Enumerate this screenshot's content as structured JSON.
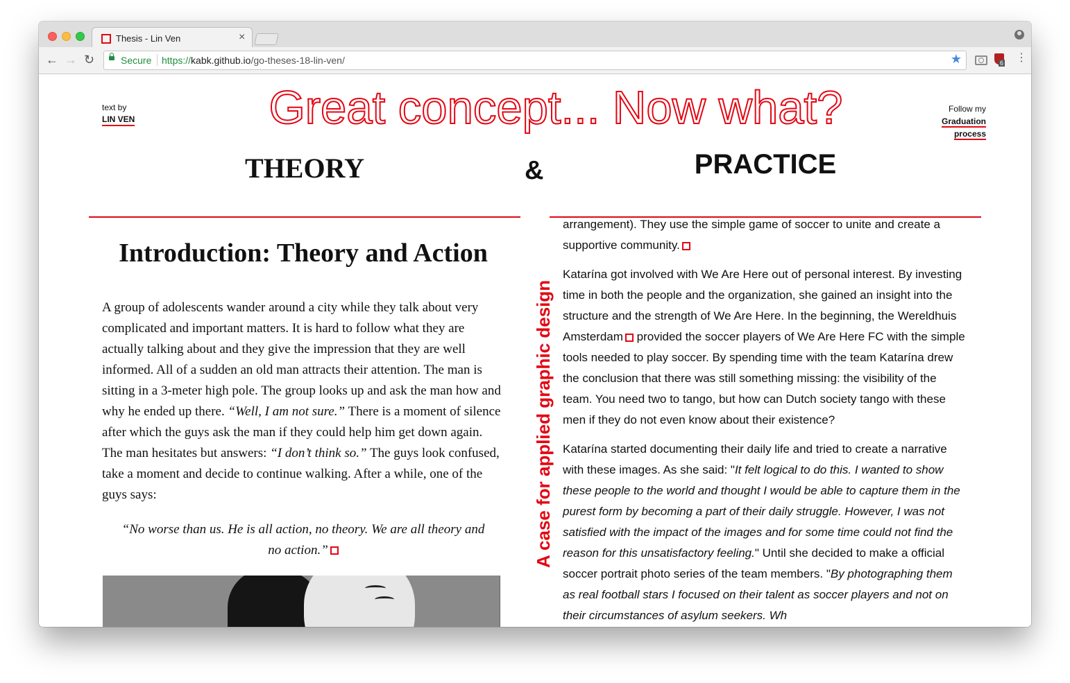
{
  "browser": {
    "tab_title": "Thesis - Lin Ven",
    "tab_close": "×",
    "secure_label": "Secure",
    "url_scheme": "https://",
    "url_host": "kabk.github.io",
    "url_path": "/go-theses-18-lin-ven/",
    "extension_badge": "6",
    "back_icon": "←",
    "forward_icon": "→",
    "reload_icon": "↻",
    "star_icon": "★",
    "menu_icon": "⋮"
  },
  "header": {
    "author_label": "text by",
    "author_name": "LIN VEN",
    "headline": "Great concept... Now what?",
    "follow_label": "Follow my",
    "follow_link_1": "Graduation",
    "follow_link_2": "process"
  },
  "columns": {
    "theory": "THEORY",
    "amp": "&",
    "practice": "PRACTICE",
    "vertical_tagline": "A case for applied graphic design"
  },
  "theory": {
    "title": "Introduction: Theory and Action",
    "p1_a": "A group of adolescents wander around a city while they talk about very complicated and important matters. It is hard to follow what they are actually talking about and they give the impression that they are well informed. All of a sudden an old man attracts their attention. The man is sitting in a 3-meter high pole. The group looks up and ask the man how and why he ended up there. ",
    "p1_quote1": "“Well, I am not sure.”",
    "p1_b": " There is a moment of silence after which the guys ask the man if they could help him get down again. The man hesitates but answers: ",
    "p1_quote2": "“I don’t think so.”",
    "p1_c": " The guys look confused, take a moment and decide to continue walking. After a while, one of the guys says:",
    "blockquote": "“No worse than us. He is all action, no theory. We are all theory and no action.”"
  },
  "practice": {
    "p0": "only a night shelter (commonly referred to as Bed, Bath and Bread arrangement). They use the simple game of soccer to unite and create a supportive community.",
    "p1_a": "Katarína got involved with We Are Here out of personal interest. By investing time in both the people and the organization, she gained an insight into the structure and the strength of We Are Here. In the beginning, the Wereldhuis Amsterdam",
    "p1_b": " provided the soccer players of We Are Here FC with the simple tools needed to play soccer. By spending time with the team Katarína drew the conclusion that there was still something missing: the visibility of the team. You need two to tango, but how can Dutch society tango with these men if they do not even know about their existence?",
    "p2_a": "Katarína started documenting their daily life and tried to create a narrative with these images. As she said: \"",
    "p2_quote1": "It felt logical to do this. I wanted to show these people to the world and thought I would be able to capture them in the purest form by becoming a part of their daily struggle. However, I was not satisfied with the impact of the images and for some time could not find the reason for this unsatisfactory feeling.",
    "p2_b": "\" Until she decided to make a official soccer portrait photo series of the team members. \"",
    "p2_quote2": "By photographing them as real football stars I focused on their talent as soccer players and not on their circumstances of asylum seekers. Wh"
  },
  "colors": {
    "accent": "#e30613",
    "secure_green": "#1e8e3e"
  }
}
